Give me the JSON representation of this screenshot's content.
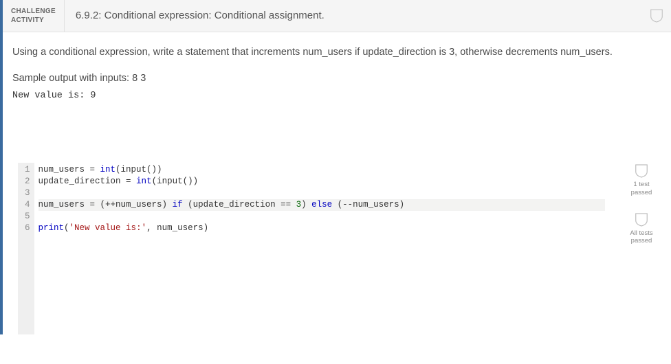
{
  "header": {
    "tag": "CHALLENGE\nACTIVITY",
    "title": "6.9.2: Conditional expression: Conditional assignment."
  },
  "prompt": "Using a conditional expression, write a statement that increments num_users if update_direction is 3, otherwise decrements num_users.",
  "sample_label": "Sample output with inputs: 8 3",
  "sample_output": "New value is: 9",
  "editor": {
    "gutter": [
      "1",
      "2",
      "3",
      "4",
      "5",
      "6"
    ],
    "lines": {
      "l1a": "num_users = ",
      "l1b": "int",
      "l1c": "(input())",
      "l2a": "update_direction = ",
      "l2b": "int",
      "l2c": "(input())",
      "l3": "",
      "l4a": "num_users = (++num_users) ",
      "l4b": "if",
      "l4c": " (update_direction == ",
      "l4d": "3",
      "l4e": ") ",
      "l4f": "else",
      "l4g": " (--num_users)",
      "l5": "",
      "l6a": "print",
      "l6b": "(",
      "l6c": "'New value is:'",
      "l6d": ", num_users)"
    }
  },
  "side": {
    "item1": "1 test\npassed",
    "item2": "All tests\npassed"
  }
}
